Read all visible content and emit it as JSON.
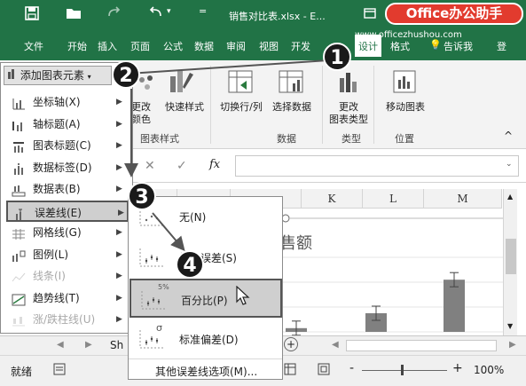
{
  "titlebar": {
    "save_icon": "save-icon",
    "open_icon": "folder-icon",
    "redo_icon": "redo-icon",
    "undo_icon": "undo-icon",
    "title": "销售对比表.xlsx - E...",
    "badge": "Office办公助手"
  },
  "ribbon_tabs": {
    "file": "文件",
    "home": "开始",
    "insert": "插入",
    "layout": "页面",
    "formula": "公式",
    "data": "数据",
    "review": "审阅",
    "view": "视图",
    "dev": "开发",
    "design": "设计",
    "format": "格式",
    "tellme": "告诉我",
    "login": "登",
    "website": "www.officezhushou.com"
  },
  "ribbon": {
    "quick_color": "更改\n颜色",
    "quick_style": "快速样式",
    "switch": "切换行/列",
    "select_data": "选择数据",
    "change_type_1": "更改",
    "change_type_2": "图表类型",
    "move_chart": "移动图表",
    "grp_styles": "图表样式",
    "grp_data": "数据",
    "grp_type": "类型",
    "grp_position": "位置",
    "color_partial": "更改",
    "color_partial2": "颜色"
  },
  "formula": {
    "fx": "fx",
    "x": "✕",
    "check": "✓"
  },
  "columns": [
    "K",
    "L",
    "M"
  ],
  "chart": {
    "title_fragment": "售额",
    "values": [
      0.05,
      0.25,
      0.7
    ]
  },
  "menu1": {
    "header": "添加图表元素",
    "items": [
      {
        "label": "坐标轴(X)",
        "icon": "axis-icon",
        "disabled": false,
        "selected": false
      },
      {
        "label": "轴标题(A)",
        "icon": "axis-title-icon",
        "disabled": false,
        "selected": false
      },
      {
        "label": "图表标题(C)",
        "icon": "chart-title-icon",
        "disabled": false,
        "selected": false
      },
      {
        "label": "数据标签(D)",
        "icon": "data-label-icon",
        "disabled": false,
        "selected": false
      },
      {
        "label": "数据表(B)",
        "icon": "data-table-icon",
        "disabled": false,
        "selected": false
      },
      {
        "label": "误差线(E)",
        "icon": "error-bar-icon",
        "disabled": false,
        "selected": true
      },
      {
        "label": "网格线(G)",
        "icon": "gridline-icon",
        "disabled": false,
        "selected": false
      },
      {
        "label": "图例(L)",
        "icon": "legend-icon",
        "disabled": false,
        "selected": false
      },
      {
        "label": "线条(I)",
        "icon": "line-icon",
        "disabled": true,
        "selected": false
      },
      {
        "label": "趋势线(T)",
        "icon": "trendline-icon",
        "disabled": false,
        "selected": false
      },
      {
        "label": "涨/跌柱线(U)",
        "icon": "updown-bar-icon",
        "disabled": true,
        "selected": false
      }
    ]
  },
  "menu2": {
    "items": [
      {
        "label": "无(N)",
        "tag": ""
      },
      {
        "label": "标准误差(S)",
        "tag": ""
      },
      {
        "label": "百分比(P)",
        "tag": "5%"
      },
      {
        "label": "标准偏差(D)",
        "tag": "σ"
      }
    ],
    "more": "其他误差线选项(M)..."
  },
  "callouts": [
    "1",
    "2",
    "3",
    "4"
  ],
  "sheettabs": {
    "sheet": "Sh",
    "add": "+"
  },
  "status": {
    "ready": "就绪",
    "zoom": "100%",
    "minus": "-",
    "plus": "+"
  }
}
